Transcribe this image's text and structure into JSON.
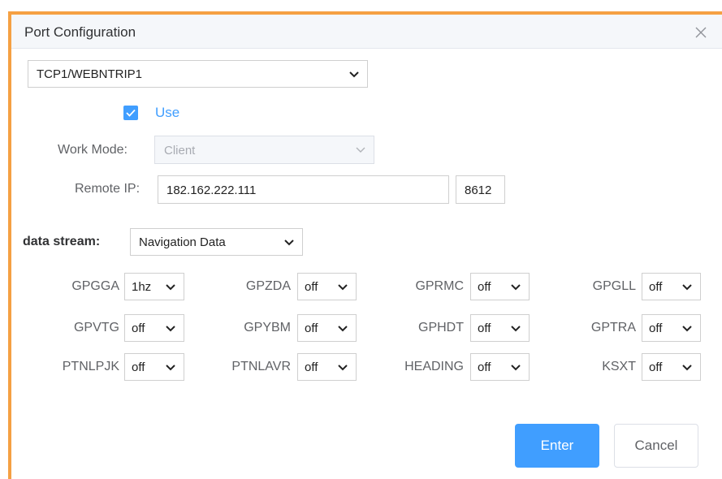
{
  "dialog": {
    "title": "Port Configuration"
  },
  "port_select": {
    "value": "TCP1/WEBNTRIP1"
  },
  "use": {
    "label": "Use",
    "checked": true
  },
  "work_mode": {
    "label": "Work Mode:",
    "value": "Client"
  },
  "remote": {
    "label": "Remote IP:",
    "ip": "182.162.222.111",
    "port": "8612"
  },
  "data_stream": {
    "label": "data stream:",
    "value": "Navigation Data"
  },
  "messages": [
    {
      "name": "GPGGA",
      "rate": "1hz"
    },
    {
      "name": "GPZDA",
      "rate": "off"
    },
    {
      "name": "GPRMC",
      "rate": "off"
    },
    {
      "name": "GPGLL",
      "rate": "off"
    },
    {
      "name": "GPVTG",
      "rate": "off"
    },
    {
      "name": "GPYBM",
      "rate": "off"
    },
    {
      "name": "GPHDT",
      "rate": "off"
    },
    {
      "name": "GPTRA",
      "rate": "off"
    },
    {
      "name": "PTNLPJK",
      "rate": "off"
    },
    {
      "name": "PTNLAVR",
      "rate": "off"
    },
    {
      "name": "HEADING",
      "rate": "off"
    },
    {
      "name": "KSXT",
      "rate": "off"
    }
  ],
  "buttons": {
    "enter": "Enter",
    "cancel": "Cancel"
  },
  "colors": {
    "accent": "#409eff",
    "frame": "#f5a043"
  }
}
